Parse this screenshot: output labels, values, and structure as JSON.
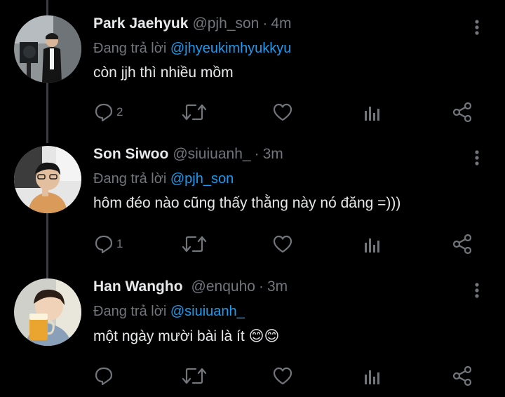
{
  "replying_prefix": "Đang trả lời",
  "tweets": [
    {
      "name": "Park Jaehyuk",
      "handle": "@pjh_son",
      "sep": "·",
      "time": "4m",
      "reply_to": "@jhyeukimhyukkyu",
      "text": "còn jjh thì nhiều mồm",
      "reply_count": "2"
    },
    {
      "name": "Son Siwoo",
      "handle": "@siuiuanh_",
      "sep": "·",
      "time": "3m",
      "reply_to": "@pjh_son",
      "text": "hôm đéo nào cũng thấy thằng này nó đăng =)))",
      "reply_count": "1"
    },
    {
      "name": "Han Wangho",
      "handle": "@enquho",
      "sep": "·",
      "time": "3m",
      "reply_to": "@siuiuanh_",
      "text": "một ngày mười bài là ít 😊😊",
      "reply_count": ""
    }
  ],
  "icons": {
    "reply": "reply-icon",
    "retweet": "retweet-icon",
    "like": "heart-icon",
    "stats": "stats-icon",
    "share": "share-icon",
    "more": "more-icon"
  },
  "colors": {
    "background": "#000000",
    "primary_text": "#e7e9ea",
    "secondary_text": "#71767b",
    "link": "#1d9bf0",
    "thread_line": "#3a3d41"
  }
}
